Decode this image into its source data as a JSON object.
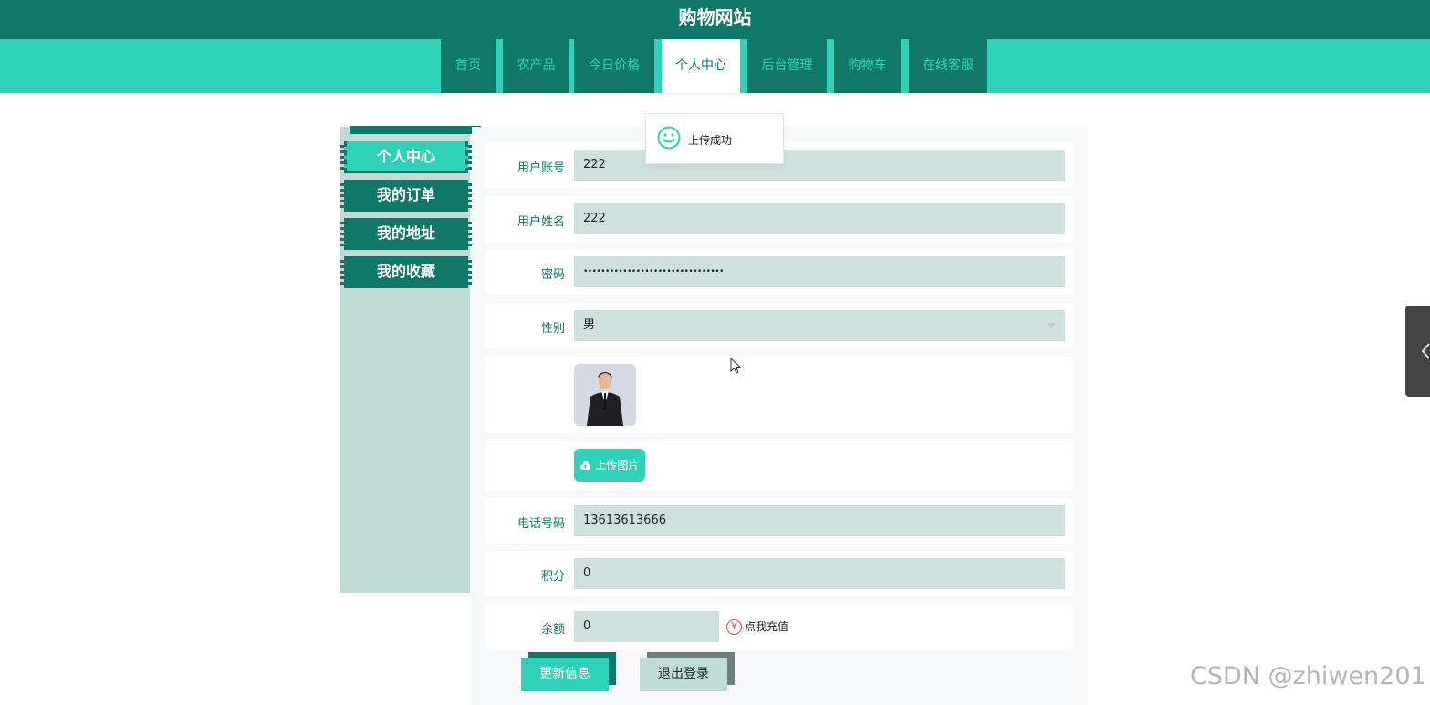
{
  "header": {
    "title": "购物网站"
  },
  "nav": {
    "items": [
      {
        "label": "首页"
      },
      {
        "label": "农产品"
      },
      {
        "label": "今日价格"
      },
      {
        "label": "个人中心"
      },
      {
        "label": "后台管理"
      },
      {
        "label": "购物车"
      },
      {
        "label": "在线客服"
      }
    ],
    "active": "个人中心"
  },
  "sidebar": {
    "items": [
      {
        "label": "个人中心"
      },
      {
        "label": "我的订单"
      },
      {
        "label": "我的地址"
      },
      {
        "label": "我的收藏"
      }
    ],
    "active": "个人中心"
  },
  "form": {
    "account": {
      "label": "用户账号",
      "value": "222"
    },
    "name": {
      "label": "用户姓名",
      "value": "222"
    },
    "password": {
      "label": "密码",
      "value": "••••••••••••••••••••••••••••••••"
    },
    "gender": {
      "label": "性别",
      "value": "男"
    },
    "upload_label": "上传图片",
    "phone": {
      "label": "电话号码",
      "value": "13613613666"
    },
    "points": {
      "label": "积分",
      "value": "0"
    },
    "balance": {
      "label": "余额",
      "value": "0"
    },
    "recharge_label": "点我充值",
    "recharge_symbol": "¥"
  },
  "actions": {
    "update_label": "更新信息",
    "logout_label": "退出登录"
  },
  "toast": {
    "message": "上传成功"
  },
  "watermark": "CSDN @zhiwen201",
  "colors": {
    "primary_dark": "#0f7868",
    "primary_light": "#2fd1b8",
    "sidebar_bg": "#c0dcd7",
    "field_bg": "#cfe1df",
    "danger": "#e04b4b"
  }
}
